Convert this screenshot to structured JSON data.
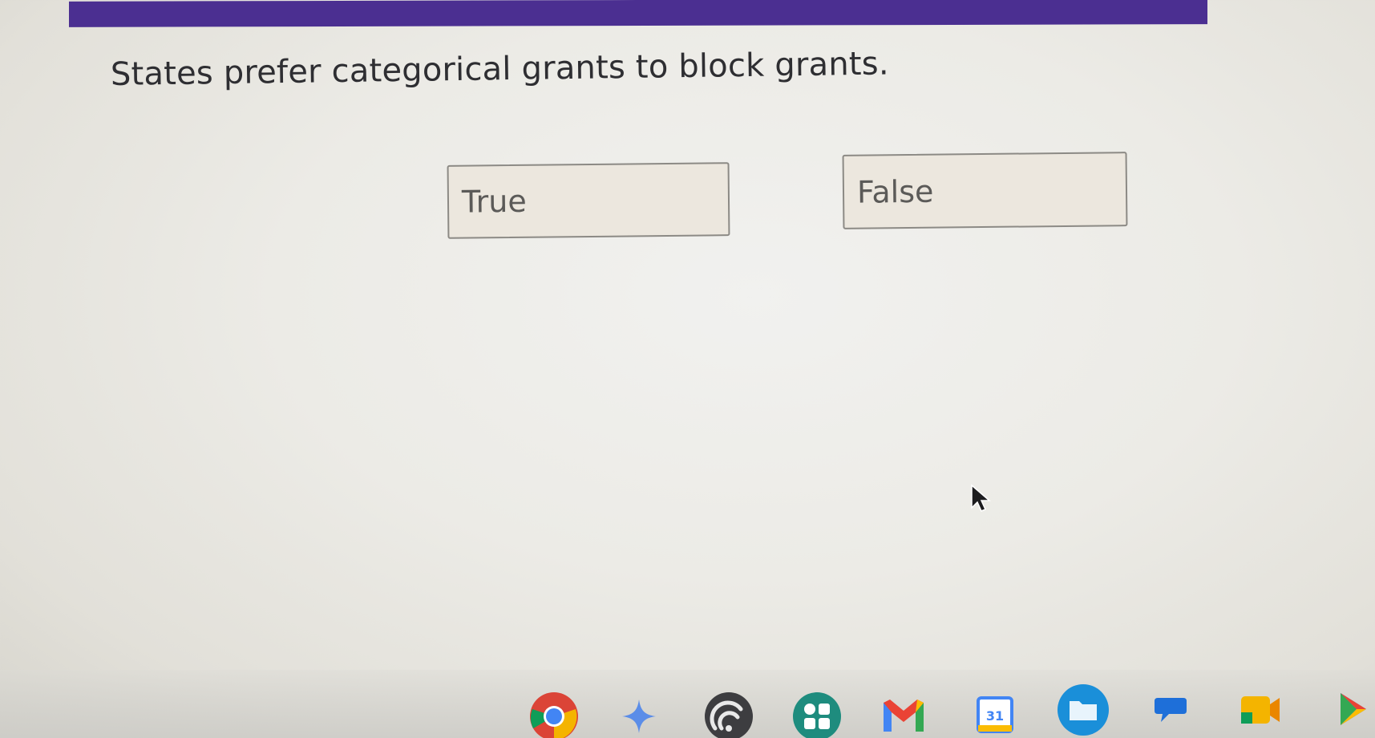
{
  "question": {
    "text": "States prefer categorical grants to block grants."
  },
  "choices": [
    {
      "label": "True"
    },
    {
      "label": "False"
    }
  ],
  "shelf": {
    "calendar_day": "31",
    "icons": [
      "chrome-icon",
      "gemini-icon",
      "podcast-icon",
      "launcher-apps-icon",
      "gmail-icon",
      "calendar-icon",
      "files-icon",
      "chat-icon",
      "meet-icon",
      "play-store-icon"
    ]
  },
  "colors": {
    "top_bar": "#4b2f91",
    "choice_fill": "#ece7de",
    "choice_border": "#8c8a85",
    "question_text": "#2e2e32"
  }
}
